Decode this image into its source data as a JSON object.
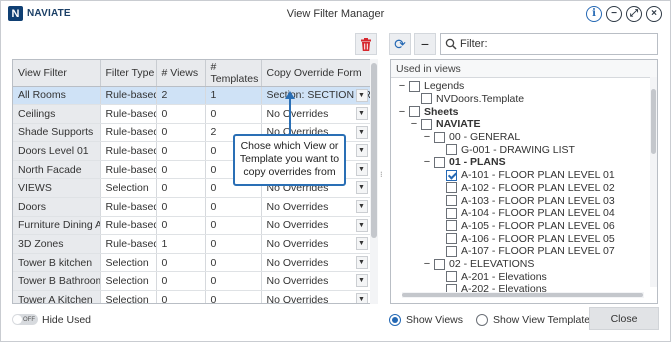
{
  "titlebar": {
    "logo_letter": "N",
    "logo_text": "NAVIATE",
    "title": "View Filter Manager",
    "info_icon": "info-icon",
    "minimize_icon": "minimize-icon",
    "restore_icon": "restore-icon",
    "close_icon": "close-icon"
  },
  "table": {
    "headers": [
      "View Filter",
      "Filter Type",
      "# Views",
      "# Templates",
      "Copy Override Form"
    ],
    "rows": [
      {
        "name": "All Rooms",
        "type": "Rule-based",
        "views": "2",
        "templates": "1",
        "override": "Section: SECTION - RO...",
        "selected": true
      },
      {
        "name": "Ceilings",
        "type": "Rule-based",
        "views": "0",
        "templates": "0",
        "override": "No Overrides"
      },
      {
        "name": "Shade Supports",
        "type": "Rule-based",
        "views": "0",
        "templates": "2",
        "override": "No Overrides"
      },
      {
        "name": "Doors Level 01",
        "type": "Rule-based",
        "views": "0",
        "templates": "0",
        "override": "No Overrides"
      },
      {
        "name": "North Facade",
        "type": "Rule-based",
        "views": "0",
        "templates": "0",
        "override": "No Overrides"
      },
      {
        "name": "VIEWS",
        "type": "Selection",
        "views": "0",
        "templates": "0",
        "override": "No Overrides"
      },
      {
        "name": "Doors",
        "type": "Rule-based",
        "views": "0",
        "templates": "0",
        "override": "No Overrides"
      },
      {
        "name": "Furniture Dining Area",
        "type": "Rule-based",
        "views": "0",
        "templates": "0",
        "override": "No Overrides"
      },
      {
        "name": "3D Zones",
        "type": "Rule-based",
        "views": "1",
        "templates": "0",
        "override": "No Overrides"
      },
      {
        "name": "Tower B kitchen",
        "type": "Selection",
        "views": "0",
        "templates": "0",
        "override": "No Overrides"
      },
      {
        "name": "Tower B Bathroom",
        "type": "Selection",
        "views": "0",
        "templates": "0",
        "override": "No Overrides"
      },
      {
        "name": "Tower A Kitchen",
        "type": "Selection",
        "views": "0",
        "templates": "0",
        "override": "No Overrides"
      }
    ]
  },
  "callout": {
    "line1": "Chose which View or",
    "line2": "Template you want to",
    "line3": "copy overrides from"
  },
  "right": {
    "filter_placeholder": "Filter:",
    "tree_header": "Used in views",
    "tree": [
      {
        "label": "Legends",
        "level": 0,
        "toggle": "−",
        "checked": false,
        "bold": false
      },
      {
        "label": "NVDoors.Template",
        "level": 1,
        "toggle": "",
        "checked": false,
        "bold": false
      },
      {
        "label": "Sheets",
        "level": 0,
        "toggle": "−",
        "checked": false,
        "bold": true
      },
      {
        "label": "NAVIATE",
        "level": 1,
        "toggle": "−",
        "checked": false,
        "bold": true
      },
      {
        "label": "00 - GENERAL",
        "level": 2,
        "toggle": "−",
        "checked": false,
        "bold": false
      },
      {
        "label": "G-001 - DRAWING LIST",
        "level": 3,
        "toggle": "",
        "checked": false,
        "bold": false
      },
      {
        "label": "01 - PLANS",
        "level": 2,
        "toggle": "−",
        "checked": false,
        "bold": true
      },
      {
        "label": "A-101 - FLOOR PLAN LEVEL 01",
        "level": 3,
        "toggle": "",
        "checked": true,
        "bold": false
      },
      {
        "label": "A-102 - FLOOR PLAN LEVEL 02",
        "level": 3,
        "toggle": "",
        "checked": false,
        "bold": false
      },
      {
        "label": "A-103 - FLOOR PLAN LEVEL 03",
        "level": 3,
        "toggle": "",
        "checked": false,
        "bold": false
      },
      {
        "label": "A-104 - FLOOR PLAN LEVEL 04",
        "level": 3,
        "toggle": "",
        "checked": false,
        "bold": false
      },
      {
        "label": "A-105 - FLOOR PLAN LEVEL 06",
        "level": 3,
        "toggle": "",
        "checked": false,
        "bold": false
      },
      {
        "label": "A-106 - FLOOR PLAN LEVEL 05",
        "level": 3,
        "toggle": "",
        "checked": false,
        "bold": false
      },
      {
        "label": "A-107 - FLOOR PLAN LEVEL 07",
        "level": 3,
        "toggle": "",
        "checked": false,
        "bold": false
      },
      {
        "label": "02 - ELEVATIONS",
        "level": 2,
        "toggle": "−",
        "checked": false,
        "bold": false
      },
      {
        "label": "A-201 - Elevations",
        "level": 3,
        "toggle": "",
        "checked": false,
        "bold": false
      },
      {
        "label": "A-202 - Elevations",
        "level": 3,
        "toggle": "",
        "checked": false,
        "bold": false
      }
    ]
  },
  "footer": {
    "toggle_state": "OFF",
    "hide_used_label": "Hide Used",
    "show_views_label": "Show Views",
    "show_templates_label": "Show View Templates",
    "show_views_selected": true,
    "close_label": "Close"
  },
  "colors": {
    "accent": "#2468b4",
    "selected_row": "#cfe2f6",
    "delete_red": "#d6262d"
  }
}
